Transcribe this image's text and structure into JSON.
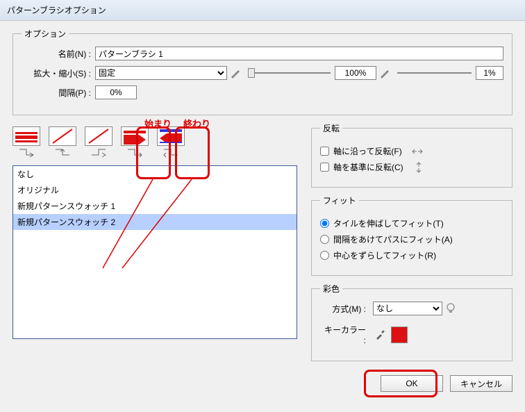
{
  "title": "パターンブラシオプション",
  "options": {
    "legend": "オプション",
    "name_label": "名前(N) :",
    "name_value": "パターンブラシ 1",
    "scale_label": "拡大・縮小(S) :",
    "scale_mode": "固定",
    "scale_value": "100%",
    "scale_value2": "1%",
    "spacing_label": "間隔(P) :",
    "spacing_value": "0%"
  },
  "annotations": {
    "start": "始まり",
    "end": "終わり"
  },
  "list_items": [
    "なし",
    "オリジナル",
    "新規パターンスウォッチ 1",
    "新規パターンスウォッチ 2"
  ],
  "flip": {
    "legend": "反転",
    "along": "軸に沿って反転(F)",
    "across": "軸を基準に反転(C)"
  },
  "fit": {
    "legend": "フィット",
    "stretch": "タイルを伸ばしてフィット(T)",
    "gap": "間隔をあけてパスにフィット(A)",
    "shift": "中心をずらしてフィット(R)"
  },
  "color": {
    "legend": "彩色",
    "method_label": "方式(M) :",
    "method_value": "なし",
    "key_label": "キーカラー :"
  },
  "buttons": {
    "ok": "OK",
    "cancel": "キャンセル"
  }
}
